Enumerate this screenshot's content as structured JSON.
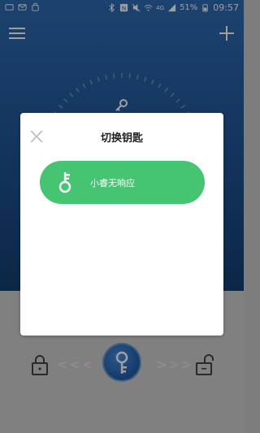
{
  "status_bar": {
    "battery": "51%",
    "time": "09:57",
    "network": "4G"
  },
  "dialog": {
    "title": "切换钥匙",
    "keys": [
      {
        "label": "小睿无响应",
        "color": "#45c472"
      }
    ]
  },
  "controls": {
    "left_arrows": "<<<",
    "right_arrows": ">>>"
  },
  "colors": {
    "header_blue": "#2e6cb4",
    "key_green": "#45c472"
  }
}
